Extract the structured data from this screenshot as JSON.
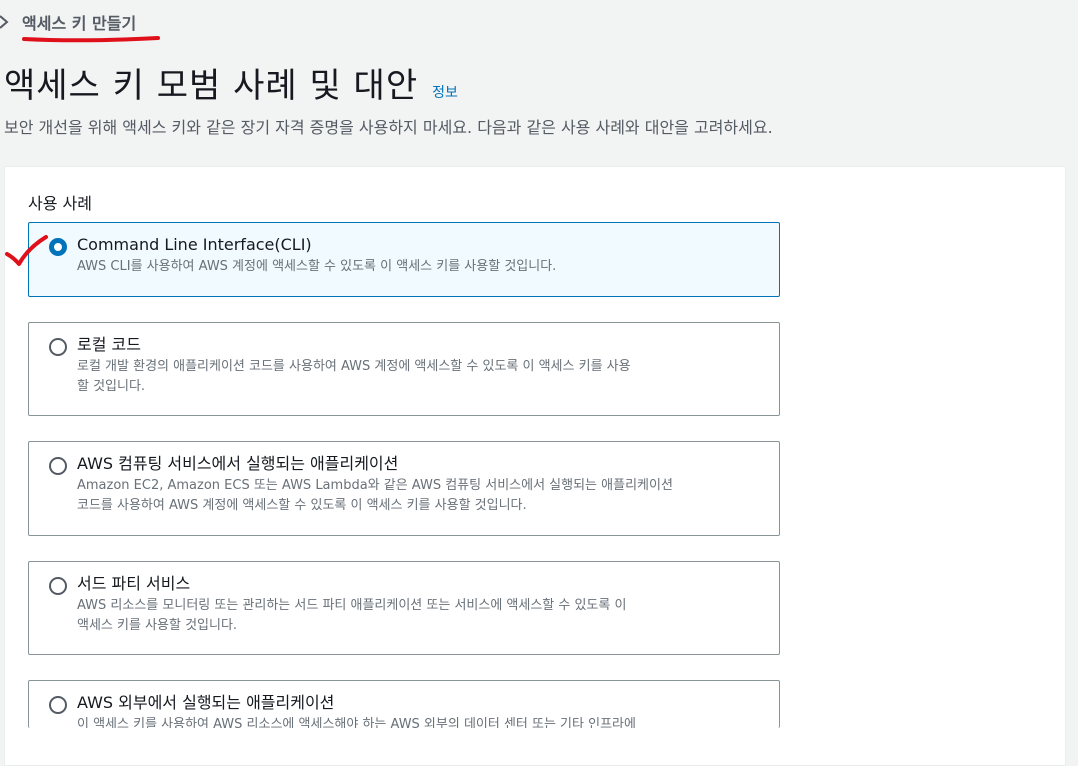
{
  "breadcrumb": {
    "current": "액세스 키 만들기"
  },
  "header": {
    "title": "액세스 키 모범 사례 및 대안",
    "info": "정보",
    "description": "보안 개선을 위해 액세스 키와 같은 장기 자격 증명을 사용하지 마세요. 다음과 같은 사용 사례와 대안을 고려하세요."
  },
  "use_cases": {
    "label": "사용 사례",
    "selected_index": 0,
    "options": [
      {
        "title": "Command Line Interface(CLI)",
        "desc_lines": [
          "AWS CLI를 사용하여 AWS 계정에 액세스할 수 있도록 이 액세스 키를 사용할 것입니다."
        ]
      },
      {
        "title": "로컬 코드",
        "desc_lines": [
          "로컬 개발 환경의 애플리케이션 코드를 사용하여 AWS 계정에 액세스할 수 있도록 이 액세스 키를 사용",
          "할 것입니다."
        ]
      },
      {
        "title": "AWS 컴퓨팅 서비스에서 실행되는 애플리케이션",
        "desc_lines": [
          "Amazon EC2, Amazon ECS 또는 AWS Lambda와 같은 AWS 컴퓨팅 서비스에서 실행되는 애플리케이션",
          "코드를 사용하여 AWS 계정에 액세스할 수 있도록 이 액세스 키를 사용할 것입니다."
        ]
      },
      {
        "title": "서드 파티 서비스",
        "desc_lines": [
          "AWS 리소스를 모니터링 또는 관리하는 서드 파티 애플리케이션 또는 서비스에 액세스할 수 있도록 이",
          "액세스 키를 사용할 것입니다."
        ]
      },
      {
        "title": "AWS 외부에서 실행되는 애플리케이션",
        "desc_lines": [
          "이 액세스 키를 사용하여 AWS 리소스에 액세스해야 하는 AWS 외부의 데이터 센터 또는 기타 인프라에"
        ]
      }
    ]
  },
  "colors": {
    "accent": "#0073bb",
    "annotation": "#e0101a"
  }
}
